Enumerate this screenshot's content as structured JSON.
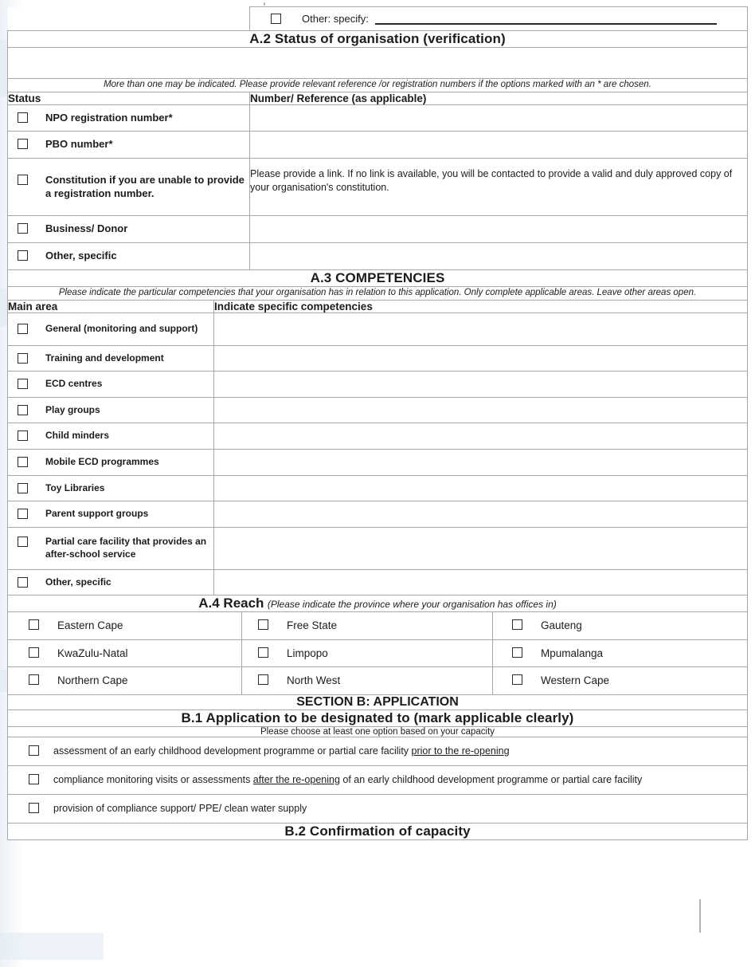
{
  "top_row": {
    "other_label": "Other: specify:",
    "checkbox": "unchecked"
  },
  "a2": {
    "title": "A.2 Status of organisation (verification)",
    "note": "More than one may be indicated. Please provide relevant reference /or registration numbers if the options marked with an * are chosen.",
    "headers": {
      "left": "Status",
      "right": "Number/ Reference (as applicable)"
    },
    "rows": [
      {
        "label": "NPO registration number*",
        "value": ""
      },
      {
        "label": "PBO number*",
        "value": ""
      },
      {
        "label": "Constitution if you are unable to provide a registration number.",
        "value": "Please provide a link. If no link is available, you will be contacted to provide a valid and duly approved copy of your organisation's constitution."
      },
      {
        "label": "Business/ Donor",
        "value": ""
      },
      {
        "label": "Other, specific",
        "value": ""
      }
    ]
  },
  "a3": {
    "title": "A.3 COMPETENCIES",
    "note": "Please indicate the particular competencies that your organisation has in relation to this application. Only complete applicable areas. Leave other areas open.",
    "headers": {
      "left": "Main area",
      "right": "Indicate specific competencies"
    },
    "rows": [
      {
        "label": "General (monitoring and support)",
        "value": ""
      },
      {
        "label": "Training and development",
        "value": ""
      },
      {
        "label": "ECD centres",
        "value": ""
      },
      {
        "label": "Play groups",
        "value": ""
      },
      {
        "label": "Child minders",
        "value": ""
      },
      {
        "label": "Mobile ECD programmes",
        "value": ""
      },
      {
        "label": "Toy Libraries",
        "value": ""
      },
      {
        "label": "Parent support groups",
        "value": ""
      },
      {
        "label": "Partial care facility that provides an after-school service",
        "value": ""
      },
      {
        "label": "Other, specific",
        "value": ""
      }
    ]
  },
  "a4": {
    "title_bold": "A.4 Reach",
    "title_italic": "(Please indicate the province where your organisation has offices in)",
    "provinces": [
      [
        "Eastern Cape",
        "Free State",
        "Gauteng"
      ],
      [
        "KwaZulu-Natal",
        "Limpopo",
        "Mpumalanga"
      ],
      [
        "Northern Cape",
        "North West",
        "Western Cape"
      ]
    ]
  },
  "section_b": {
    "title": "SECTION B: APPLICATION",
    "b1": {
      "title": "B.1 Application to be designated to (mark applicable clearly)",
      "note": "Please choose at least one option based on your capacity",
      "options": [
        {
          "pre": "assessment of an early childhood development programme or partial care facility ",
          "underline": "prior to the re-opening",
          "post": ""
        },
        {
          "pre": "compliance monitoring visits or assessments ",
          "underline": "after the re-opening",
          "post": " of an early childhood development programme or partial care facility"
        },
        {
          "pre": "provision of compliance support/ PPE/ clean water supply",
          "underline": "",
          "post": ""
        }
      ]
    },
    "b2": {
      "title": "B.2 Confirmation of capacity"
    }
  },
  "colors": {
    "border": "#a8a8a8",
    "text": "#1c1c1c",
    "scan_tint": "#eef2f6"
  }
}
